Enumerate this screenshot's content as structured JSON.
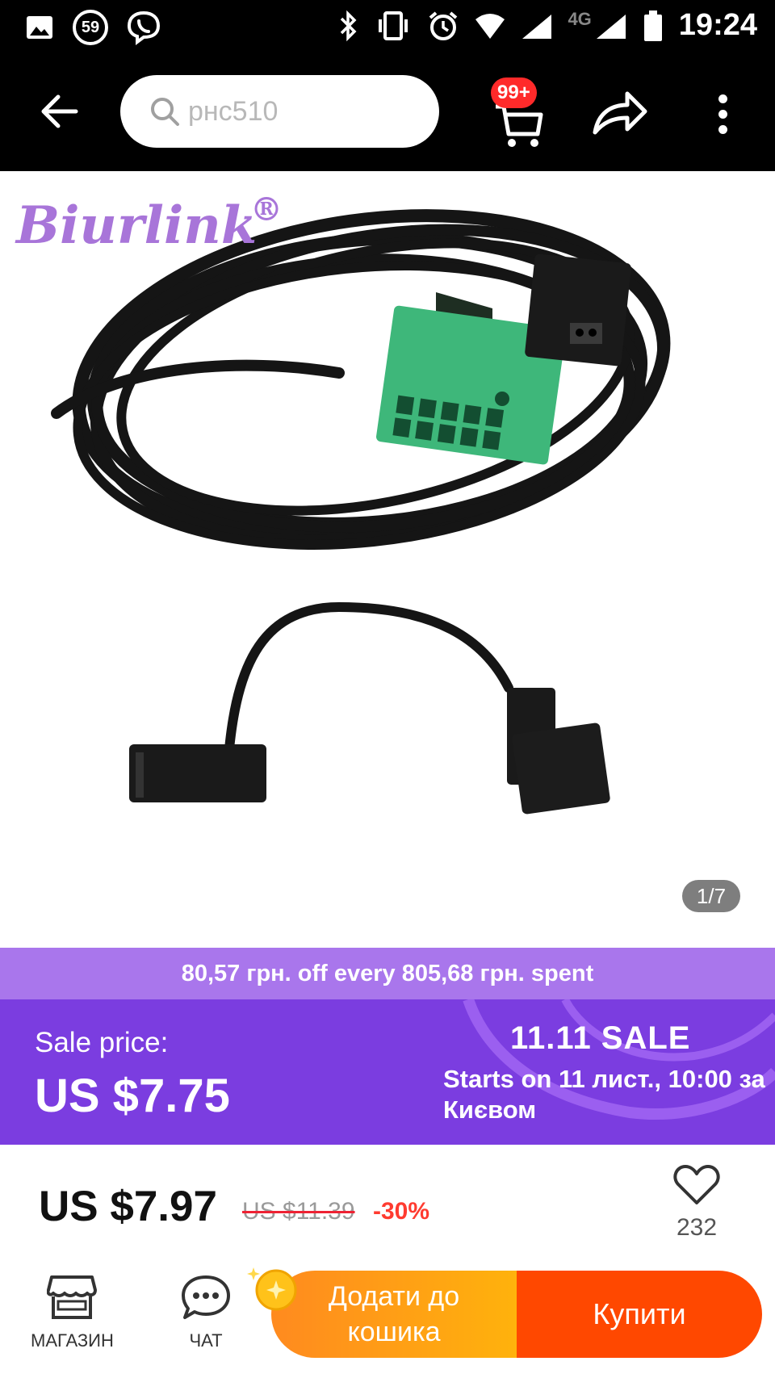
{
  "status_bar": {
    "notification_count": "59",
    "network_label": "4G",
    "time": "19:24"
  },
  "header": {
    "search_value": "рнс510",
    "cart_badge": "99+"
  },
  "gallery": {
    "brand": "Biurlink",
    "registered_mark": "®",
    "counter": "1/7"
  },
  "promo": {
    "text": "80,57 грн. off every 805,68 грн. spent"
  },
  "sale": {
    "label": "Sale price:",
    "price": "US $7.75",
    "event_name": "11.11 SALE",
    "starts_text": "Starts on 11 лист., 10:00 за Києвом"
  },
  "pricing": {
    "current": "US $7.97",
    "original": "US $11.39",
    "discount": "-30%",
    "wishlist_count": "232"
  },
  "bottom_bar": {
    "store_label": "МАГАЗИН",
    "chat_label": "ЧАТ",
    "add_to_cart_label": "Додати до кошика",
    "buy_label": "Купити"
  },
  "colors": {
    "promo_strip": "#a976ec",
    "sale_banner": "#7b3de0",
    "add_to_cart": "#ffa20f",
    "buy_now": "#ff4800",
    "discount": "#ff3b30",
    "brand_logo": "#a875d9"
  }
}
